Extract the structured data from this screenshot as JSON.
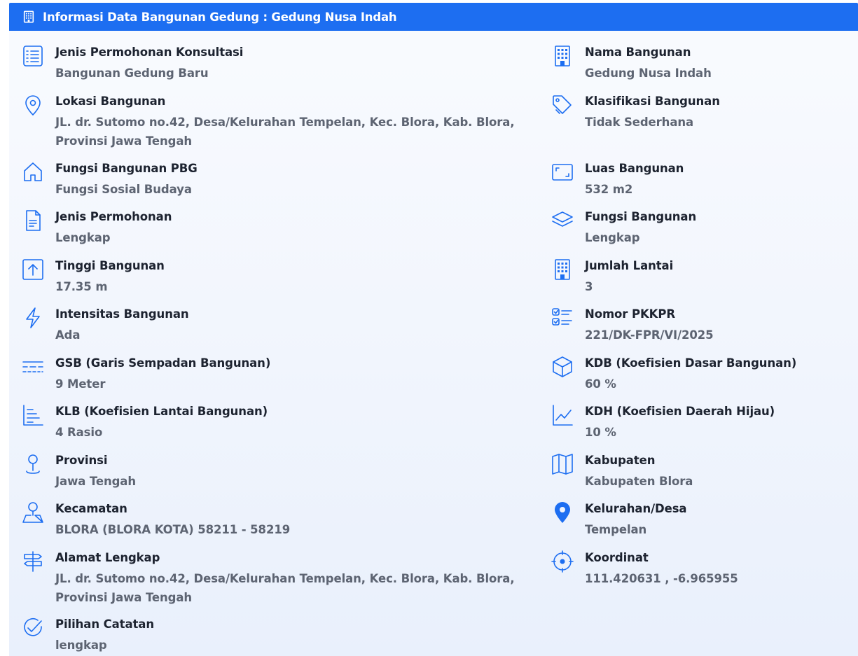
{
  "header": {
    "title": "Informasi Data Bangunan Gedung : Gedung Nusa Indah",
    "icon": "building-icon"
  },
  "colors": {
    "accent": "#1d6ef1",
    "label": "#1d2330",
    "value": "#5d6472"
  },
  "left": [
    {
      "label": "Jenis Permohonan Konsultasi",
      "value": "Bangunan Gedung Baru",
      "icon": "list-icon"
    },
    {
      "label": "Lokasi Bangunan",
      "value": "JL. dr. Sutomo no.42, Desa/Kelurahan Tempelan, Kec. Blora, Kab. Blora, Provinsi Jawa Tengah",
      "icon": "location-pin-icon"
    },
    {
      "label": "Fungsi Bangunan PBG",
      "value": "Fungsi Sosial Budaya",
      "icon": "home-icon"
    },
    {
      "label": "Jenis Permohonan",
      "value": "Lengkap",
      "icon": "document-icon"
    },
    {
      "label": "Tinggi Bangunan",
      "value": "17.35 m",
      "icon": "arrow-up-box-icon"
    },
    {
      "label": "Intensitas Bangunan",
      "value": "Ada",
      "icon": "lightning-icon"
    },
    {
      "label": "GSB (Garis Sempadan Bangunan)",
      "value": "9 Meter",
      "icon": "dashed-lines-icon"
    },
    {
      "label": "KLB (Koefisien Lantai Bangunan)",
      "value": "4 Rasio",
      "icon": "bar-steps-icon"
    },
    {
      "label": "Provinsi",
      "value": "Jawa Tengah",
      "icon": "map-marker-icon"
    },
    {
      "label": "Kecamatan",
      "value": "BLORA (BLORA KOTA) 58211 - 58219",
      "icon": "person-location-icon"
    },
    {
      "label": "Alamat Lengkap",
      "value": "JL. dr. Sutomo no.42, Desa/Kelurahan Tempelan, Kec. Blora, Kab. Blora, Provinsi Jawa Tengah",
      "icon": "signpost-icon"
    },
    {
      "label": "Pilihan Catatan",
      "value": "lengkap",
      "icon": "check-circle-icon"
    }
  ],
  "right": [
    {
      "label": "Nama Bangunan",
      "value": "Gedung Nusa Indah",
      "icon": "building-icon"
    },
    {
      "label": "Klasifikasi Bangunan",
      "value": "Tidak Sederhana",
      "icon": "tags-icon"
    },
    {
      "label": "Luas Bangunan",
      "value": "532 m2",
      "icon": "area-frame-icon"
    },
    {
      "label": "Fungsi Bangunan",
      "value": "Lengkap",
      "icon": "layers-icon"
    },
    {
      "label": "Jumlah Lantai",
      "value": "3",
      "icon": "building-icon"
    },
    {
      "label": "Nomor PKKPR",
      "value": "221/DK-FPR/VI/2025",
      "icon": "checklist-icon"
    },
    {
      "label": "KDB (Koefisien Dasar Bangunan)",
      "value": "60 %",
      "icon": "cube-icon"
    },
    {
      "label": "KDH (Koefisien Daerah Hijau)",
      "value": "10 %",
      "icon": "line-chart-icon"
    },
    {
      "label": "Kabupaten",
      "value": "Kabupaten Blora",
      "icon": "map-icon"
    },
    {
      "label": "Kelurahan/Desa",
      "value": "Tempelan",
      "icon": "filled-pin-icon"
    },
    {
      "label": "Koordinat",
      "value": "111.420631 , -6.965955",
      "icon": "crosshair-icon"
    }
  ]
}
